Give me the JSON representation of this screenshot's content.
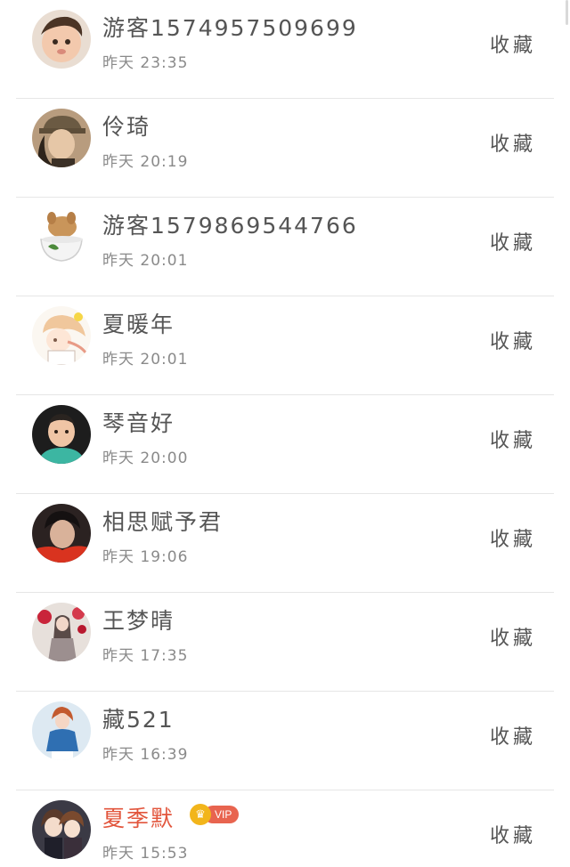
{
  "rows": [
    {
      "name": "游客1574957509699",
      "time": "昨天 23:35",
      "action": "收藏"
    },
    {
      "name": "伶琦",
      "time": "昨天 20:19",
      "action": "收藏"
    },
    {
      "name": "游客1579869544766",
      "time": "昨天 20:01",
      "action": "收藏"
    },
    {
      "name": "夏暖年",
      "time": "昨天 20:01",
      "action": "收藏"
    },
    {
      "name": "琴音好",
      "time": "昨天 20:00",
      "action": "收藏"
    },
    {
      "name": "相思赋予君",
      "time": "昨天 19:06",
      "action": "收藏"
    },
    {
      "name": "王梦晴",
      "time": "昨天 17:35",
      "action": "收藏"
    },
    {
      "name": "藏521",
      "time": "昨天 16:39",
      "action": "收藏"
    },
    {
      "name": "夏季默",
      "time": "昨天 15:53",
      "action": "收藏",
      "vip_label": "VIP"
    }
  ],
  "colors": {
    "name": "#555555",
    "vip_name": "#e2553c",
    "time": "#8a8a8a",
    "divider": "#e6e6e6"
  }
}
